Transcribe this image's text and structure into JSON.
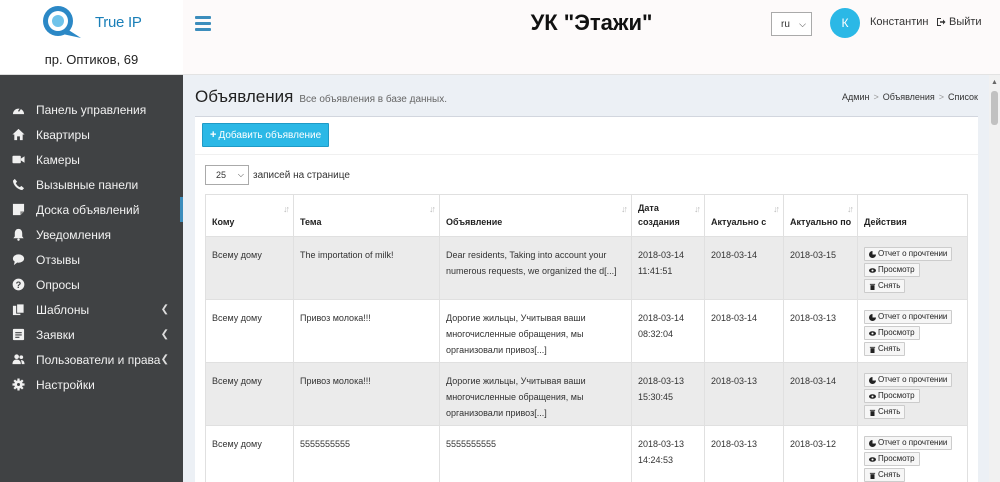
{
  "brand": {
    "logo_text": "True IP",
    "address": "пр. Оптиков, 69"
  },
  "header": {
    "title": "УК \"Этажи\"",
    "language": "ru",
    "avatar_initial": "К",
    "user_name": "Константин",
    "logout_label": "Выйти"
  },
  "sidebar": {
    "items": [
      {
        "label": "Панель управления",
        "icon": "dashboard-icon"
      },
      {
        "label": "Квартиры",
        "icon": "home-icon"
      },
      {
        "label": "Камеры",
        "icon": "video-camera-icon"
      },
      {
        "label": "Вызывные панели",
        "icon": "phone-icon"
      },
      {
        "label": "Доска объявлений",
        "icon": "sticky-note-icon",
        "active": true
      },
      {
        "label": "Уведомления",
        "icon": "bell-icon"
      },
      {
        "label": "Отзывы",
        "icon": "comments-icon"
      },
      {
        "label": "Опросы",
        "icon": "question-circle-icon"
      },
      {
        "label": "Шаблоны",
        "icon": "copy-icon",
        "has_submenu": true
      },
      {
        "label": "Заявки",
        "icon": "tasks-icon",
        "has_submenu": true
      },
      {
        "label": "Пользователи и права",
        "icon": "users-icon",
        "has_submenu": true
      },
      {
        "label": "Настройки",
        "icon": "gear-icon"
      }
    ]
  },
  "page": {
    "title": "Объявления",
    "subtitle": "Все объявления в базе данных.",
    "breadcrumb": [
      "Админ",
      "Объявления",
      "Список"
    ],
    "add_button": "Добавить объявление",
    "page_length": "25",
    "page_length_label": "записей на странице"
  },
  "table": {
    "columns": [
      "Кому",
      "Тема",
      "Объявление",
      "Дата создания",
      "Актуально с",
      "Актуально по",
      "Действия"
    ],
    "action_labels": {
      "report": "Отчет о прочтении",
      "view": "Просмотр",
      "remove": "Снять"
    },
    "rows": [
      {
        "to": "Всему дому",
        "subject": "The importation of milk!",
        "text": "Dear residents, Taking into account your numerous requests, we organized the d[...]",
        "created_date": "2018-03-14",
        "created_time": "11:41:51",
        "valid_from": "2018-03-14",
        "valid_to": "2018-03-15"
      },
      {
        "to": "Всему дому",
        "subject": "Привоз молока!!!",
        "text": "Дорогие жильцы, Учитывая ваши многочисленные обращения, мы организовали привоз[...]",
        "created_date": "2018-03-14",
        "created_time": "08:32:04",
        "valid_from": "2018-03-14",
        "valid_to": "2018-03-13"
      },
      {
        "to": "Всему дому",
        "subject": "Привоз молока!!!",
        "text": "Дорогие жильцы, Учитывая ваши многочисленные обращения, мы организовали привоз[...]",
        "created_date": "2018-03-13",
        "created_time": "15:30:45",
        "valid_from": "2018-03-13",
        "valid_to": "2018-03-14"
      },
      {
        "to": "Всему дому",
        "subject": "5555555555",
        "text": "5555555555",
        "created_date": "2018-03-13",
        "created_time": "14:24:53",
        "valid_from": "2018-03-13",
        "valid_to": "2018-03-12"
      }
    ]
  },
  "colors": {
    "accent": "#2bb8e6",
    "sidebar_bg": "#404244",
    "link": "#3c8dbc"
  }
}
